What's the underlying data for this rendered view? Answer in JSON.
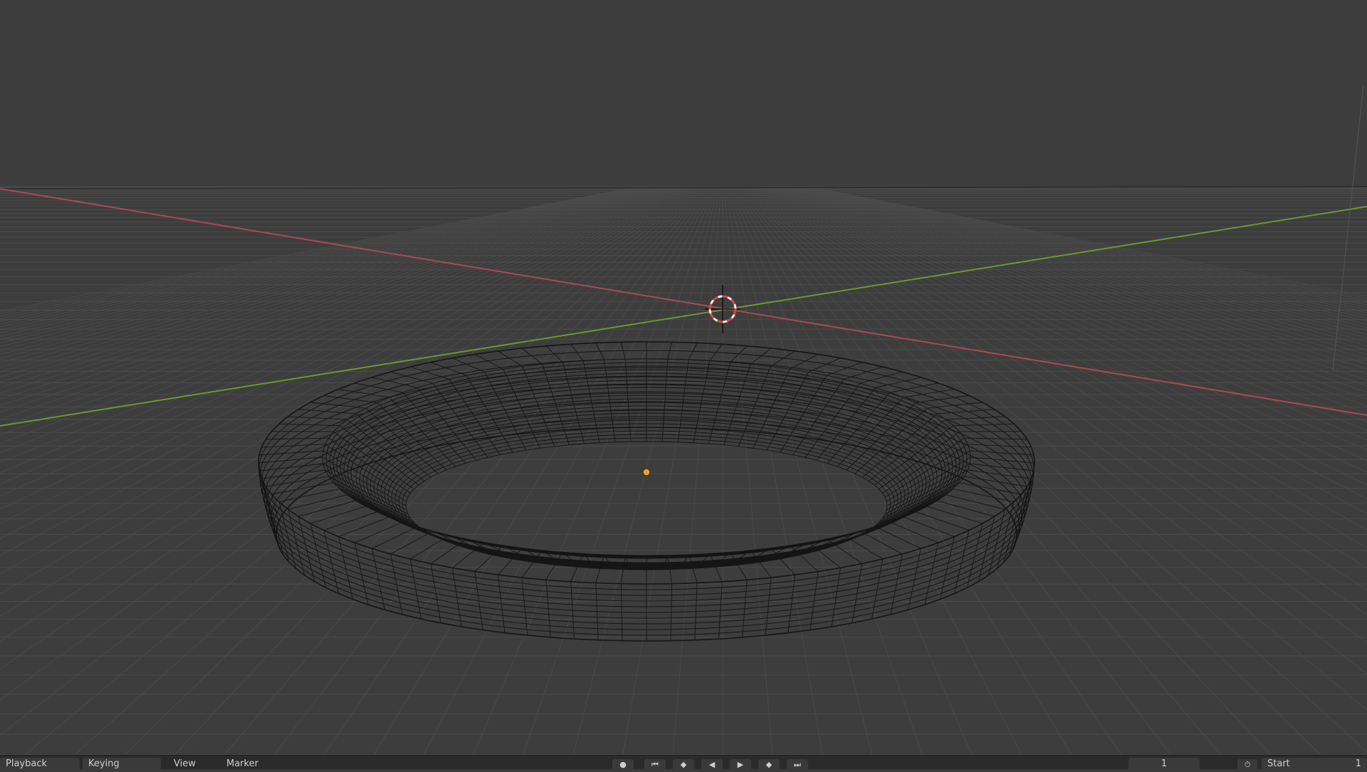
{
  "viewport": {
    "background": "#3d3d3d",
    "grid_color": "#4c4c4c",
    "x_axis_color": "#a94a55",
    "y_axis_color": "#6b9a2c",
    "mesh_wire_color": "#151515",
    "origin_dot_color": "#f5a01a",
    "cursor_red": "#d84646",
    "cursor_white": "#f0f0f0"
  },
  "timeline": {
    "playback_label": "Playback",
    "keying_label": "Keying",
    "view_label": "View",
    "marker_label": "Marker",
    "controls": [
      {
        "name": "record-button",
        "glyph": "●"
      },
      {
        "name": "jump-start-button",
        "glyph": "⏮"
      },
      {
        "name": "prev-keyframe-button",
        "glyph": "◆"
      },
      {
        "name": "play-reverse-button",
        "glyph": "◀"
      },
      {
        "name": "play-button",
        "glyph": "▶"
      },
      {
        "name": "next-keyframe-button",
        "glyph": "◆"
      },
      {
        "name": "jump-end-button",
        "glyph": "⏭"
      }
    ],
    "current_frame": "1",
    "start_label": "Start",
    "start_value": "1"
  }
}
